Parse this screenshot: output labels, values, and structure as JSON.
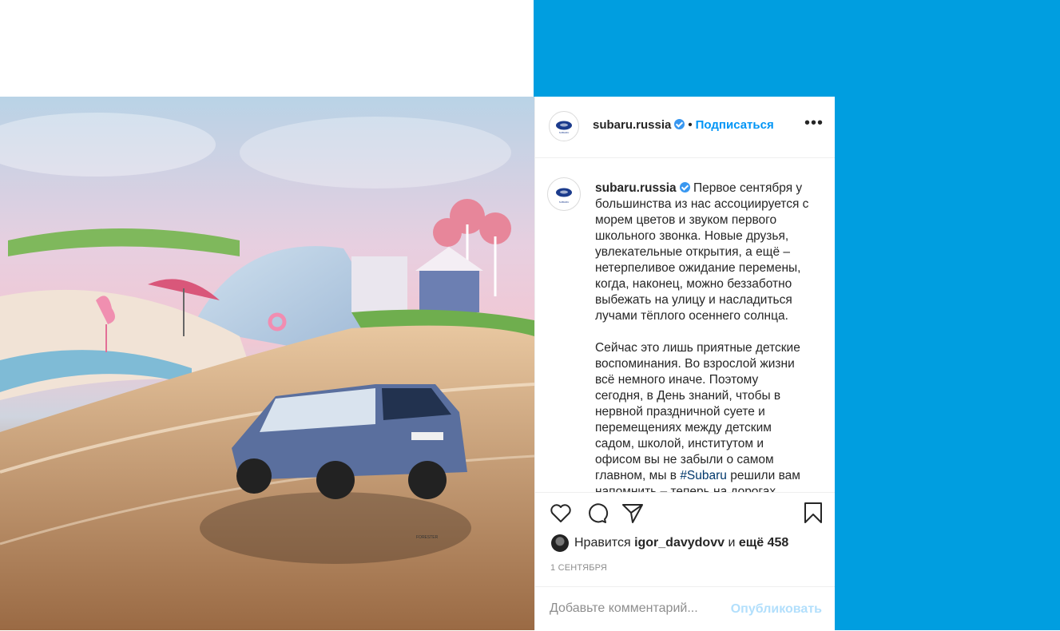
{
  "post": {
    "username": "subaru.russia",
    "separator": "•",
    "follow_label": "Подписаться",
    "more_label": "•••",
    "avatar_text": "SUBARU",
    "caption_line1": "Первое сентября у\nбольшинства из нас ассоциируется с\nморем цветов и звуком первого\nшкольного звонка. Новые друзья,\nувлекательные открытия, а ещё –\nнетерпеливое ожидание перемены,\nкогда, наконец, можно беззаботно\nвыбежать на улицу и насладиться\nлучами тёплого осеннего солнца.",
    "caption_para2": "Сейчас это лишь приятные детские\nвоспоминания. Во взрослой жизни\nвсё немного иначе. Поэтому\nсегодня, в День знаний, чтобы в\nнервной праздничной суете и\nперемещениях между детским\nсадом, школой, институтом и\nофисом вы не забыли о самом\nглавном, мы в ",
    "hashtag": "#Subaru",
    "caption_para2_tail": " решили вам\nнапомнить – теперь на дорогах",
    "likes_prefix": "Нравится",
    "likes_user": "igor_davydovv",
    "likes_and": "и",
    "likes_more": "ещё 458",
    "date": "1 сентября",
    "comment_placeholder": "Добавьте комментарий...",
    "publish_label": "Опубликовать",
    "car_badge": "FORESTER"
  },
  "colors": {
    "accent_blue": "#0095f6",
    "background_blue": "#009ee0",
    "verified": "#3897f0",
    "publish_disabled": "#b2dffc"
  },
  "icons": [
    "heart-icon",
    "comment-icon",
    "share-icon",
    "bookmark-icon",
    "verified-icon",
    "more-icon"
  ]
}
